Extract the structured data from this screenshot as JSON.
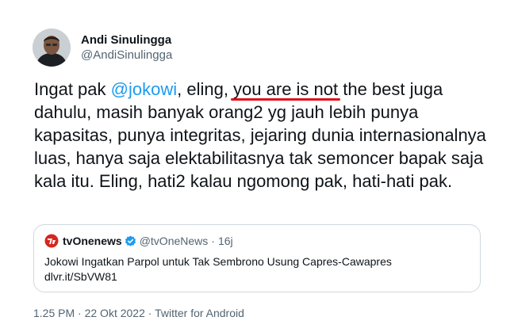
{
  "author": {
    "display_name": "Andi Sinulingga",
    "handle": "@AndiSinulingga"
  },
  "tweet": {
    "prefix": "Ingat pak ",
    "mention": "@jokowi",
    "between": ", eling, ",
    "highlight": "you are is not",
    "rest": " the best juga dahulu, masih banyak orang2 yg jauh lebih punya kapasitas, punya integritas, jejaring dunia internasionalnya luas, hanya saja elektabilitasnya tak semoncer bapak saja kala itu. Eling, hati2 kalau ngomong pak, hati-hati pak."
  },
  "quote": {
    "name": "tvOnenews",
    "handle": "@tvOneNews",
    "separator": "·",
    "time": "16j",
    "line1": "Jokowi Ingatkan Parpol untuk Tak Sembrono Usung Capres-Cawapres",
    "line2": "dlvr.it/SbVW81"
  },
  "meta": {
    "time": "1.25 PM",
    "sep1": "·",
    "date": "22 Okt 2022",
    "sep2": "·",
    "source": "Twitter for Android"
  },
  "colors": {
    "accent": "#1d9bf0",
    "underline": "#e0101a",
    "muted": "#536471",
    "border": "#cfd9de"
  }
}
